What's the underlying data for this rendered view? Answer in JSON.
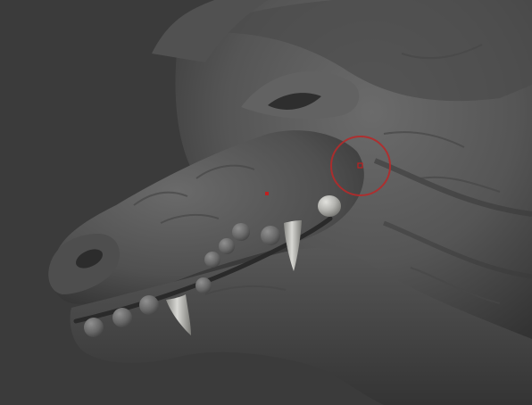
{
  "viewport": {
    "background_color": "#3b3b3b",
    "model_color": "#5c5c5c",
    "tooth_color": "#b4b4b0"
  },
  "model": {
    "name": "dragon-head-sculpt",
    "icon": "sculpt-model-icon"
  },
  "brush_cursor": {
    "icon": "brush-cursor-icon",
    "color": "#c02020",
    "ring_color": "#b52a2a"
  },
  "pivot_marker": {
    "icon": "pivot-dot-icon",
    "color": "#c02020"
  }
}
